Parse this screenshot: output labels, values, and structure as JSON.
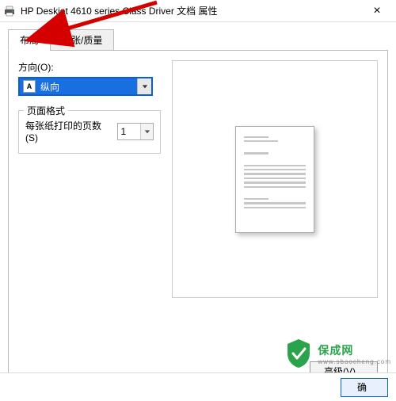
{
  "window": {
    "title": "HP Deskjet 4610 series Class Driver 文档 属性"
  },
  "tabs": {
    "layout": "布局",
    "paper_quality": "纸张/质量"
  },
  "orientation": {
    "label": "方向(O):",
    "value": "纵向"
  },
  "page_format": {
    "legend": "页面格式",
    "pages_per_sheet_label": "每张纸打印的页数(S)",
    "pages_per_sheet_value": "1"
  },
  "buttons": {
    "advanced": "高级(V)...",
    "ok_partial": "确"
  },
  "watermark": {
    "brand": "保成网",
    "domain": "www.sbaocheng.com"
  }
}
